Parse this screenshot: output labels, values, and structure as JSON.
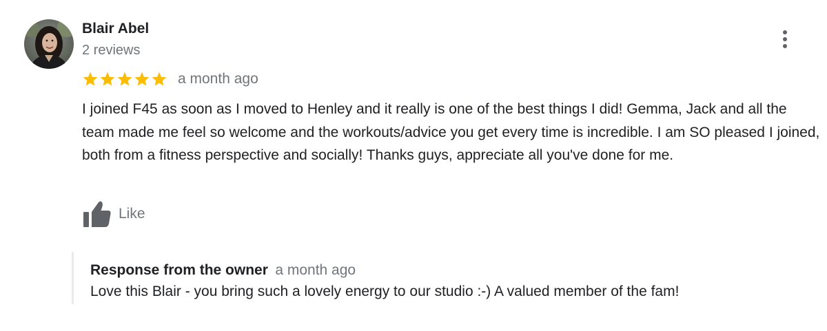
{
  "review": {
    "reviewer": {
      "name": "Blair Abel",
      "review_count": "2 reviews",
      "avatar_icon": "profile-photo"
    },
    "menu_icon": "more-vert-icon",
    "rating": {
      "stars": 5,
      "max_stars": 5,
      "star_color": "#fbbc04"
    },
    "time": "a month ago",
    "text": "I joined F45 as soon as I moved to Henley and it really is one of the best things I did! Gemma, Jack and all the team made me feel so welcome and the workouts/advice you get every time is incredible. I am SO pleased I joined, both from a fitness perspective and socially! Thanks guys, appreciate all you've done for me.",
    "like": {
      "label": "Like",
      "icon": "thumbs-up-icon"
    },
    "owner_response": {
      "title": "Response from the owner",
      "time": "a month ago",
      "text": "Love this Blair - you bring such a lovely energy to our studio :-) A valued member of the fam!"
    }
  },
  "colors": {
    "primary_text": "#202124",
    "secondary_text": "#70757a",
    "star": "#fbbc04",
    "icon_gray": "#5f6368",
    "divider": "#e8eaed"
  }
}
